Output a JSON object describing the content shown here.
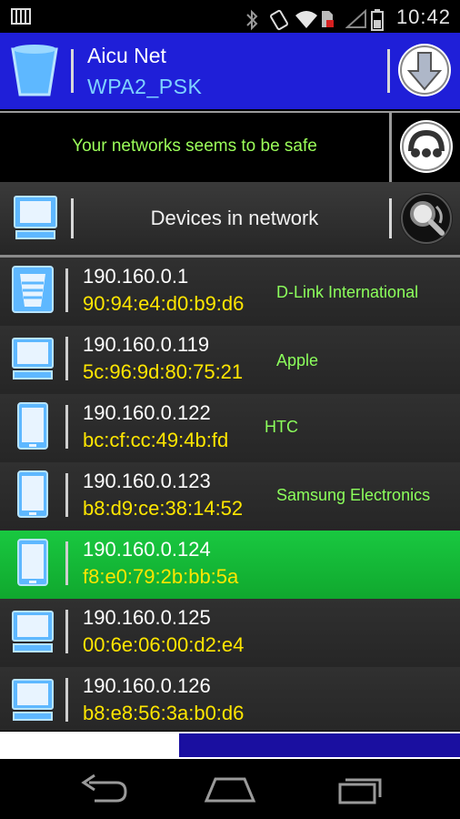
{
  "status_bar": {
    "time": "10:42",
    "icons": [
      "bluetooth-icon",
      "vibrate-icon",
      "wifi-icon",
      "sim-icon",
      "signal-icon",
      "battery-icon"
    ]
  },
  "network": {
    "name": "Aicu Net",
    "security": "WPA2_PSK"
  },
  "safety": {
    "message": "Your networks seems to be safe"
  },
  "devices_header": {
    "title": "Devices in network"
  },
  "devices": [
    {
      "ip": "190.160.0.1",
      "mac": "90:94:e4:d0:b9:d6",
      "vendor": "D-Link International",
      "type": "router",
      "selected": false
    },
    {
      "ip": "190.160.0.119",
      "mac": "5c:96:9d:80:75:21",
      "vendor": "Apple",
      "type": "computer",
      "selected": false
    },
    {
      "ip": "190.160.0.122",
      "mac": "bc:cf:cc:49:4b:fd",
      "vendor": "HTC",
      "type": "phone",
      "selected": false
    },
    {
      "ip": "190.160.0.123",
      "mac": "b8:d9:ce:38:14:52",
      "vendor": "Samsung Electronics",
      "type": "phone",
      "selected": false
    },
    {
      "ip": "190.160.0.124",
      "mac": "f8:e0:79:2b:bb:5a",
      "vendor": "",
      "type": "phone",
      "selected": true
    },
    {
      "ip": "190.160.0.125",
      "mac": "00:6e:06:00:d2:e4",
      "vendor": "",
      "type": "computer",
      "selected": false
    },
    {
      "ip": "190.160.0.126",
      "mac": "b8:e8:56:3a:b0:d6",
      "vendor": "",
      "type": "computer",
      "selected": false
    }
  ],
  "scan_progress": 0.61,
  "colors": {
    "header_blue": "#1f1fd8",
    "safe_green": "#9cff5a",
    "mac_yellow": "#ffe600",
    "vendor_green": "#8cff5c",
    "selected_green": "#19c840",
    "progress_blue": "#1a0fa0"
  },
  "nav": [
    "back-icon",
    "home-icon",
    "recents-icon"
  ]
}
